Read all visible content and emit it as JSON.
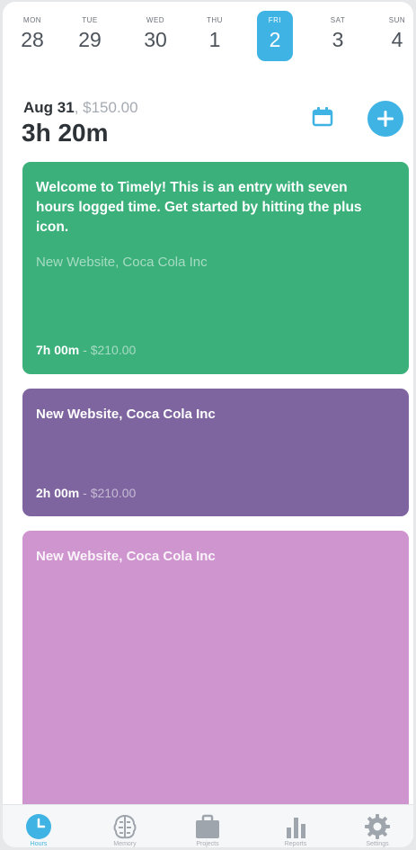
{
  "week": {
    "days": [
      {
        "name": "MON",
        "num": "28"
      },
      {
        "name": "TUE",
        "num": "29"
      },
      {
        "name": "WED",
        "num": "30"
      },
      {
        "name": "THU",
        "num": "1"
      },
      {
        "name": "FRI",
        "num": "2"
      },
      {
        "name": "SAT",
        "num": "3"
      },
      {
        "name": "SUN",
        "num": "4"
      }
    ],
    "selected_day": "FRI"
  },
  "summary": {
    "date": "Aug 31",
    "separator": ", ",
    "amount": "$150.00",
    "total": "3h 20m"
  },
  "icons": {
    "calendar": "calendar-icon",
    "add": "plus-icon"
  },
  "entries": [
    {
      "note": "Welcome to Timely! This is an entry with seven hours logged time. Get started by hitting the plus icon.",
      "project": "New Website, Coca Cola Inc",
      "duration": "7h 00m",
      "separator": " - ",
      "cost": "$210.00",
      "color": "#3bb07b"
    },
    {
      "project": "New Website, Coca Cola Inc",
      "duration": "2h 00m",
      "separator": " - ",
      "cost": "$210.00",
      "color": "#7e659f"
    },
    {
      "project": "New Website, Coca Cola Inc",
      "color": "#cf95cf"
    }
  ],
  "tabs": [
    {
      "label": "Hours",
      "icon": "clock-icon",
      "active": true
    },
    {
      "label": "Memory",
      "icon": "brain-icon",
      "active": false
    },
    {
      "label": "Projects",
      "icon": "briefcase-icon",
      "active": false
    },
    {
      "label": "Reports",
      "icon": "bar-chart-icon",
      "active": false
    },
    {
      "label": "Settings",
      "icon": "gear-icon",
      "active": false
    }
  ],
  "colors": {
    "accent": "#3fb3e3",
    "text_dark": "#2e3338",
    "text_muted": "#a5abb2",
    "tab_inactive": "#a8adb3"
  }
}
